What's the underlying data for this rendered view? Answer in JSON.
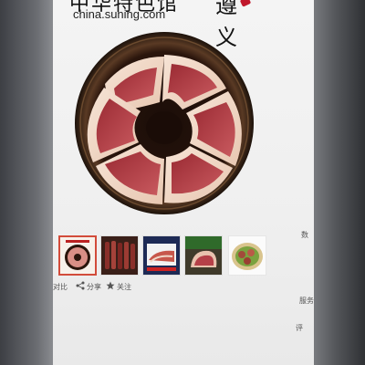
{
  "header": {
    "title_cn": "中华特色馆",
    "site_url": "china.suning.com",
    "region_mark": "遵义"
  },
  "product": {
    "main_image_icon": "cured-pork-platter-image"
  },
  "thumbnails": [
    {
      "icon": "pork-platter-thumb",
      "selected": true
    },
    {
      "icon": "sausage-bundle-thumb",
      "selected": false
    },
    {
      "icon": "sliced-pork-box-thumb",
      "selected": false
    },
    {
      "icon": "pork-slab-thumb",
      "selected": false
    },
    {
      "icon": "dish-plate-thumb",
      "selected": false
    }
  ],
  "actions": {
    "compare_label": "对比",
    "share_label": "分享",
    "follow_label": "关注"
  },
  "side_text": [
    "数",
    "服",
    "务",
    "评"
  ],
  "colors": {
    "accent": "#c0172b",
    "selected_border": "#d24b3a"
  }
}
